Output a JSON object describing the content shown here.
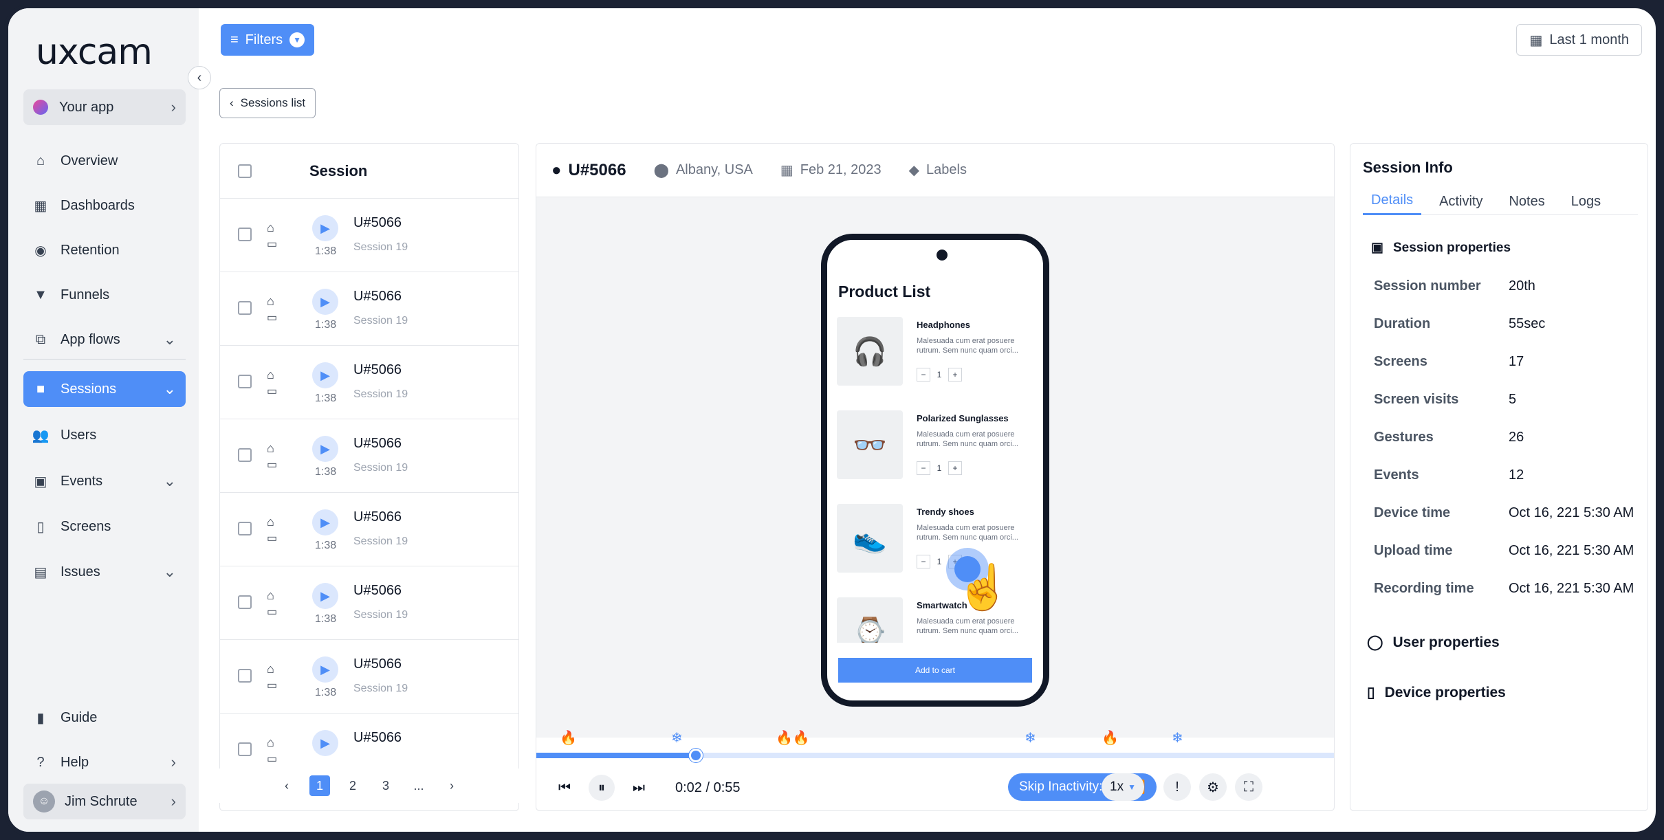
{
  "brand": {
    "logo": "uxcam",
    "accent": "#4f8ef7"
  },
  "sidebar": {
    "app_selector": "Your app",
    "items": [
      {
        "label": "Overview"
      },
      {
        "label": "Dashboards"
      },
      {
        "label": "Retention"
      },
      {
        "label": "Funnels"
      },
      {
        "label": "App flows"
      },
      {
        "label": "Sessions"
      },
      {
        "label": "Users"
      },
      {
        "label": "Events"
      },
      {
        "label": "Screens"
      },
      {
        "label": "Issues"
      }
    ],
    "bottom": [
      {
        "label": "Guide"
      },
      {
        "label": "Help"
      }
    ],
    "user": "Jim Schrute"
  },
  "toolbar": {
    "filters_label": "Filters",
    "date_range": "Last 1 month",
    "back_label": "Sessions list"
  },
  "sessions": {
    "header": "Session",
    "rows": [
      {
        "user": "U#5066",
        "duration": "1:38",
        "session": "Session 19"
      },
      {
        "user": "U#5066",
        "duration": "1:38",
        "session": "Session 19"
      },
      {
        "user": "U#5066",
        "duration": "1:38",
        "session": "Session 19"
      },
      {
        "user": "U#5066",
        "duration": "1:38",
        "session": "Session 19"
      },
      {
        "user": "U#5066",
        "duration": "1:38",
        "session": "Session 19"
      },
      {
        "user": "U#5066",
        "duration": "1:38",
        "session": "Session 19"
      },
      {
        "user": "U#5066",
        "duration": "1:38",
        "session": "Session 19"
      },
      {
        "user": "U#5066",
        "duration": "",
        "session": ""
      }
    ],
    "pages": [
      "1",
      "2",
      "3",
      "..."
    ]
  },
  "player": {
    "user": "U#5066",
    "location": "Albany, USA",
    "date": "Feb 21, 2023",
    "labels": "Labels",
    "time": "0:02 / 0:55",
    "progress": 0.2,
    "skip_label": "Skip Inactivity: On",
    "speed": "1x",
    "phone": {
      "title": "Product List",
      "products": [
        {
          "name": "Headphones",
          "desc": "Malesuada cum erat posuere rutrum. Sem nunc quam orci...",
          "qty": "1"
        },
        {
          "name": "Polarized Sunglasses",
          "desc": "Malesuada cum erat posuere rutrum. Sem nunc quam orci...",
          "qty": "1"
        },
        {
          "name": "Trendy shoes",
          "desc": "Malesuada cum erat posuere rutrum. Sem nunc quam orci...",
          "qty": "1"
        },
        {
          "name": "Smartwatch",
          "desc": "Malesuada cum erat posuere rutrum. Sem nunc quam orci...",
          "qty": ""
        }
      ],
      "cart": "Add to cart"
    }
  },
  "info": {
    "title": "Session Info",
    "tabs": [
      "Details",
      "Activity",
      "Notes",
      "Logs"
    ],
    "session_props_title": "Session properties",
    "props": [
      {
        "k": "Session number",
        "v": "20th"
      },
      {
        "k": "Duration",
        "v": "55sec"
      },
      {
        "k": "Screens",
        "v": "17"
      },
      {
        "k": "Screen visits",
        "v": "5"
      },
      {
        "k": "Gestures",
        "v": "26"
      },
      {
        "k": "Events",
        "v": "12"
      },
      {
        "k": "Device time",
        "v": "Oct 16, 221 5:30 AM"
      },
      {
        "k": "Upload time",
        "v": "Oct 16, 221 5:30 AM"
      },
      {
        "k": "Recording time",
        "v": "Oct 16, 221 5:30 AM"
      }
    ],
    "user_props": "User properties",
    "device_props": "Device properties"
  }
}
